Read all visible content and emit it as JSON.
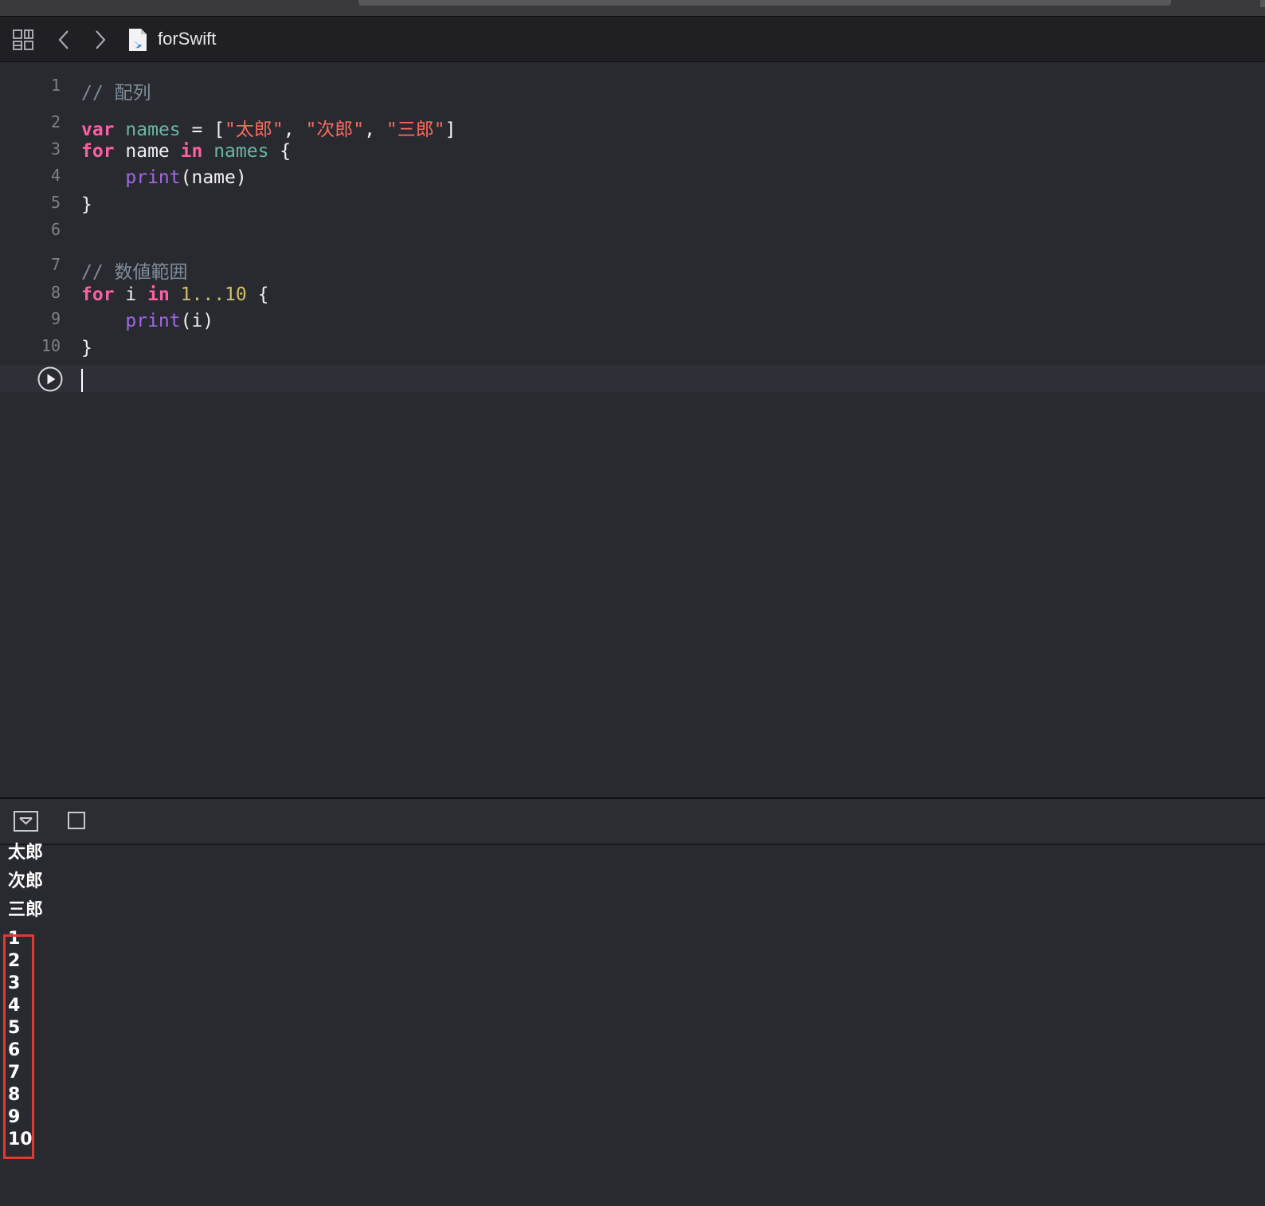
{
  "jumpbar": {
    "file_name": "forSwift",
    "icons": [
      "grid-icon",
      "chevron-left-icon",
      "chevron-right-icon",
      "swift-file-icon"
    ]
  },
  "editor": {
    "line_numbers": [
      "1",
      "2",
      "3",
      "4",
      "5",
      "6",
      "7",
      "8",
      "9",
      "10"
    ],
    "lines": [
      [
        {
          "t": "// 配列",
          "c": "cm"
        }
      ],
      [
        {
          "t": "var",
          "c": "kw"
        },
        {
          "t": " ",
          "c": "pl"
        },
        {
          "t": "names",
          "c": "vr"
        },
        {
          "t": " = [",
          "c": "pl"
        },
        {
          "t": "\"太郎\"",
          "c": "st"
        },
        {
          "t": ", ",
          "c": "pl"
        },
        {
          "t": "\"次郎\"",
          "c": "st"
        },
        {
          "t": ", ",
          "c": "pl"
        },
        {
          "t": "\"三郎\"",
          "c": "st"
        },
        {
          "t": "]",
          "c": "pl"
        }
      ],
      [
        {
          "t": "for",
          "c": "kw"
        },
        {
          "t": " name ",
          "c": "pl"
        },
        {
          "t": "in",
          "c": "kw"
        },
        {
          "t": " ",
          "c": "pl"
        },
        {
          "t": "names",
          "c": "vr"
        },
        {
          "t": " {",
          "c": "pl"
        }
      ],
      [
        {
          "t": "    ",
          "c": "pl"
        },
        {
          "t": "print",
          "c": "fn"
        },
        {
          "t": "(name)",
          "c": "pl"
        }
      ],
      [
        {
          "t": "}",
          "c": "pl"
        }
      ],
      [],
      [
        {
          "t": "// 数値範囲",
          "c": "cm"
        }
      ],
      [
        {
          "t": "for",
          "c": "kw"
        },
        {
          "t": " i ",
          "c": "pl"
        },
        {
          "t": "in",
          "c": "kw"
        },
        {
          "t": " ",
          "c": "pl"
        },
        {
          "t": "1...10",
          "c": "num"
        },
        {
          "t": " {",
          "c": "pl"
        }
      ],
      [
        {
          "t": "    ",
          "c": "pl"
        },
        {
          "t": "print",
          "c": "fn"
        },
        {
          "t": "(i)",
          "c": "pl"
        }
      ],
      [
        {
          "t": "}",
          "c": "pl"
        }
      ]
    ],
    "colors": {
      "keyword": "#fc5fa3",
      "comment": "#7f8c98",
      "string": "#fc6a5d",
      "number": "#d0bf69",
      "function": "#a167e6",
      "variable": "#67b7a4"
    }
  },
  "console_bar": {
    "icons": [
      "hide-console-icon",
      "split-view-icon"
    ]
  },
  "console": {
    "output": [
      "太郎",
      "次郎",
      "三郎",
      "1",
      "2",
      "3",
      "4",
      "5",
      "6",
      "7",
      "8",
      "9",
      "10"
    ],
    "highlight_color": "#e23a2e"
  }
}
